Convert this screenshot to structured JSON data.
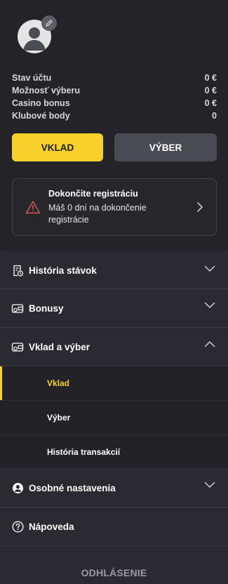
{
  "account": {
    "stats": [
      {
        "label": "Stav účtu",
        "value": "0 €"
      },
      {
        "label": "Možnosť výberu",
        "value": "0 €"
      },
      {
        "label": "Casino bonus",
        "value": "0 €"
      },
      {
        "label": "Klubové body",
        "value": "0"
      }
    ],
    "deposit_label": "VKLAD",
    "withdraw_label": "VÝBER",
    "registration": {
      "title": "Dokončite registráciu",
      "text": "Máš 0 dní na dokončenie registrácie"
    }
  },
  "menu": {
    "bet_history": "História stávok",
    "bonuses": "Bonusy",
    "deposit_withdraw": "Vklad a výber",
    "sub_items": [
      "Vklad",
      "Výber",
      "História transakcií"
    ],
    "personal_settings": "Osobné nastavenia",
    "help": "Nápoveda"
  },
  "logout_label": "ODHLÁSENIE",
  "colors": {
    "accent": "#f7d02c",
    "background": "#2a2a30",
    "card": "#232328"
  }
}
